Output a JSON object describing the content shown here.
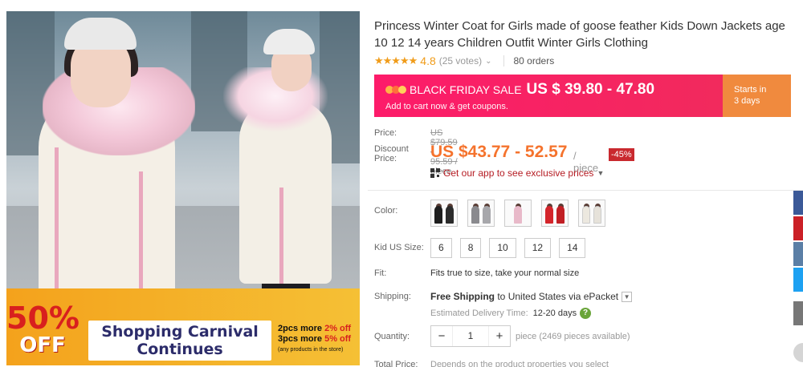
{
  "product": {
    "title": "Princess Winter Coat for Girls made of goose feather Kids Down Jackets age 10 12 14 years Children Outfit Winter Girls Clothing",
    "rating": "4.8",
    "votes": "(25 votes)",
    "orders": "80 orders"
  },
  "image_promo": {
    "off_pct": "50%",
    "off_word": "OFF",
    "line1": "Shopping Carnival",
    "line2": "Continues",
    "deal1_pre": "2pcs more ",
    "deal1_val": "2% off",
    "deal2_pre": "3pcs more ",
    "deal2_val": "5% off",
    "deal_note": "(any products in the store)"
  },
  "banner": {
    "label": "BLACK FRIDAY SALE",
    "price": "US $ 39.80 - 47.80",
    "sub": "Add to cart now & get coupons.",
    "starts_line1": "Starts in",
    "starts_line2": "3 days"
  },
  "pricing": {
    "price_label": "Price:",
    "original": "US $79.59 - 95.59 / piece",
    "discount_label_1": "Discount",
    "discount_label_2": "Price:",
    "discount_price": "US $43.77 - 52.57",
    "per": "/ piece",
    "percent_off": "-45%",
    "app_link": "Get our app to see exclusive prices"
  },
  "options": {
    "color_label": "Color:",
    "size_label": "Kid US Size:",
    "sizes": [
      "6",
      "8",
      "10",
      "12",
      "14"
    ],
    "fit_label": "Fit:",
    "fit_text": "Fits true to size, take your normal size"
  },
  "shipping": {
    "label": "Shipping:",
    "free": "Free Shipping",
    "dest": " to United States via ePacket",
    "est_label": "Estimated Delivery Time:",
    "est_days": "12-20 days"
  },
  "quantity": {
    "label": "Quantity:",
    "value": "1",
    "available": "piece (2469 pieces available)"
  },
  "total": {
    "label": "Total Price:",
    "text": "Depends on the product properties you select"
  },
  "colors": {
    "brand_red": "#fd1b6a",
    "price_orange": "#f5732d",
    "badge_red": "#c9292e"
  }
}
